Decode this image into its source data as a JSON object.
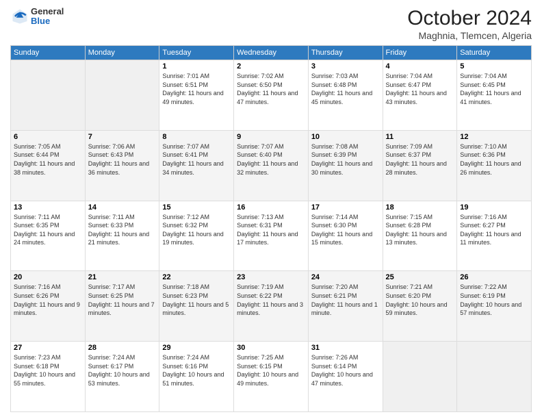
{
  "logo": {
    "general": "General",
    "blue": "Blue"
  },
  "header": {
    "month": "October 2024",
    "location": "Maghnia, Tlemcen, Algeria"
  },
  "days_of_week": [
    "Sunday",
    "Monday",
    "Tuesday",
    "Wednesday",
    "Thursday",
    "Friday",
    "Saturday"
  ],
  "weeks": [
    [
      {
        "day": "",
        "sunrise": "",
        "sunset": "",
        "daylight": "",
        "empty": true
      },
      {
        "day": "",
        "sunrise": "",
        "sunset": "",
        "daylight": "",
        "empty": true
      },
      {
        "day": "1",
        "sunrise": "Sunrise: 7:01 AM",
        "sunset": "Sunset: 6:51 PM",
        "daylight": "Daylight: 11 hours and 49 minutes."
      },
      {
        "day": "2",
        "sunrise": "Sunrise: 7:02 AM",
        "sunset": "Sunset: 6:50 PM",
        "daylight": "Daylight: 11 hours and 47 minutes."
      },
      {
        "day": "3",
        "sunrise": "Sunrise: 7:03 AM",
        "sunset": "Sunset: 6:48 PM",
        "daylight": "Daylight: 11 hours and 45 minutes."
      },
      {
        "day": "4",
        "sunrise": "Sunrise: 7:04 AM",
        "sunset": "Sunset: 6:47 PM",
        "daylight": "Daylight: 11 hours and 43 minutes."
      },
      {
        "day": "5",
        "sunrise": "Sunrise: 7:04 AM",
        "sunset": "Sunset: 6:45 PM",
        "daylight": "Daylight: 11 hours and 41 minutes."
      }
    ],
    [
      {
        "day": "6",
        "sunrise": "Sunrise: 7:05 AM",
        "sunset": "Sunset: 6:44 PM",
        "daylight": "Daylight: 11 hours and 38 minutes."
      },
      {
        "day": "7",
        "sunrise": "Sunrise: 7:06 AM",
        "sunset": "Sunset: 6:43 PM",
        "daylight": "Daylight: 11 hours and 36 minutes."
      },
      {
        "day": "8",
        "sunrise": "Sunrise: 7:07 AM",
        "sunset": "Sunset: 6:41 PM",
        "daylight": "Daylight: 11 hours and 34 minutes."
      },
      {
        "day": "9",
        "sunrise": "Sunrise: 7:07 AM",
        "sunset": "Sunset: 6:40 PM",
        "daylight": "Daylight: 11 hours and 32 minutes."
      },
      {
        "day": "10",
        "sunrise": "Sunrise: 7:08 AM",
        "sunset": "Sunset: 6:39 PM",
        "daylight": "Daylight: 11 hours and 30 minutes."
      },
      {
        "day": "11",
        "sunrise": "Sunrise: 7:09 AM",
        "sunset": "Sunset: 6:37 PM",
        "daylight": "Daylight: 11 hours and 28 minutes."
      },
      {
        "day": "12",
        "sunrise": "Sunrise: 7:10 AM",
        "sunset": "Sunset: 6:36 PM",
        "daylight": "Daylight: 11 hours and 26 minutes."
      }
    ],
    [
      {
        "day": "13",
        "sunrise": "Sunrise: 7:11 AM",
        "sunset": "Sunset: 6:35 PM",
        "daylight": "Daylight: 11 hours and 24 minutes."
      },
      {
        "day": "14",
        "sunrise": "Sunrise: 7:11 AM",
        "sunset": "Sunset: 6:33 PM",
        "daylight": "Daylight: 11 hours and 21 minutes."
      },
      {
        "day": "15",
        "sunrise": "Sunrise: 7:12 AM",
        "sunset": "Sunset: 6:32 PM",
        "daylight": "Daylight: 11 hours and 19 minutes."
      },
      {
        "day": "16",
        "sunrise": "Sunrise: 7:13 AM",
        "sunset": "Sunset: 6:31 PM",
        "daylight": "Daylight: 11 hours and 17 minutes."
      },
      {
        "day": "17",
        "sunrise": "Sunrise: 7:14 AM",
        "sunset": "Sunset: 6:30 PM",
        "daylight": "Daylight: 11 hours and 15 minutes."
      },
      {
        "day": "18",
        "sunrise": "Sunrise: 7:15 AM",
        "sunset": "Sunset: 6:28 PM",
        "daylight": "Daylight: 11 hours and 13 minutes."
      },
      {
        "day": "19",
        "sunrise": "Sunrise: 7:16 AM",
        "sunset": "Sunset: 6:27 PM",
        "daylight": "Daylight: 11 hours and 11 minutes."
      }
    ],
    [
      {
        "day": "20",
        "sunrise": "Sunrise: 7:16 AM",
        "sunset": "Sunset: 6:26 PM",
        "daylight": "Daylight: 11 hours and 9 minutes."
      },
      {
        "day": "21",
        "sunrise": "Sunrise: 7:17 AM",
        "sunset": "Sunset: 6:25 PM",
        "daylight": "Daylight: 11 hours and 7 minutes."
      },
      {
        "day": "22",
        "sunrise": "Sunrise: 7:18 AM",
        "sunset": "Sunset: 6:23 PM",
        "daylight": "Daylight: 11 hours and 5 minutes."
      },
      {
        "day": "23",
        "sunrise": "Sunrise: 7:19 AM",
        "sunset": "Sunset: 6:22 PM",
        "daylight": "Daylight: 11 hours and 3 minutes."
      },
      {
        "day": "24",
        "sunrise": "Sunrise: 7:20 AM",
        "sunset": "Sunset: 6:21 PM",
        "daylight": "Daylight: 11 hours and 1 minute."
      },
      {
        "day": "25",
        "sunrise": "Sunrise: 7:21 AM",
        "sunset": "Sunset: 6:20 PM",
        "daylight": "Daylight: 10 hours and 59 minutes."
      },
      {
        "day": "26",
        "sunrise": "Sunrise: 7:22 AM",
        "sunset": "Sunset: 6:19 PM",
        "daylight": "Daylight: 10 hours and 57 minutes."
      }
    ],
    [
      {
        "day": "27",
        "sunrise": "Sunrise: 7:23 AM",
        "sunset": "Sunset: 6:18 PM",
        "daylight": "Daylight: 10 hours and 55 minutes."
      },
      {
        "day": "28",
        "sunrise": "Sunrise: 7:24 AM",
        "sunset": "Sunset: 6:17 PM",
        "daylight": "Daylight: 10 hours and 53 minutes."
      },
      {
        "day": "29",
        "sunrise": "Sunrise: 7:24 AM",
        "sunset": "Sunset: 6:16 PM",
        "daylight": "Daylight: 10 hours and 51 minutes."
      },
      {
        "day": "30",
        "sunrise": "Sunrise: 7:25 AM",
        "sunset": "Sunset: 6:15 PM",
        "daylight": "Daylight: 10 hours and 49 minutes."
      },
      {
        "day": "31",
        "sunrise": "Sunrise: 7:26 AM",
        "sunset": "Sunset: 6:14 PM",
        "daylight": "Daylight: 10 hours and 47 minutes."
      },
      {
        "day": "",
        "sunrise": "",
        "sunset": "",
        "daylight": "",
        "empty": true
      },
      {
        "day": "",
        "sunrise": "",
        "sunset": "",
        "daylight": "",
        "empty": true
      }
    ]
  ]
}
